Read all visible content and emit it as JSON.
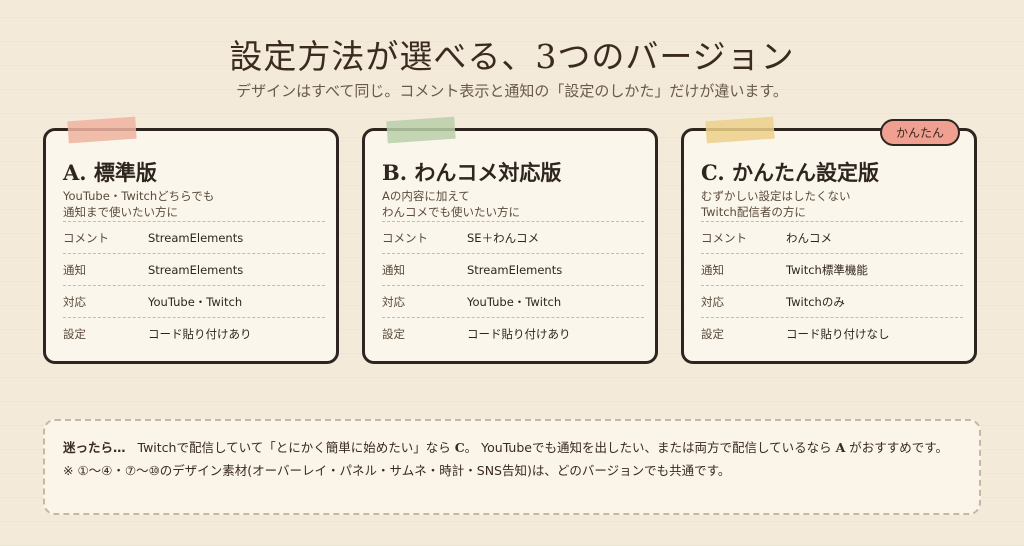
{
  "header": {
    "title": "設定方法が選べる、3つのバージョン",
    "subtitle": "デザインはすべて同じ。コメント表示と通知の「設定のしかた」だけが違います。"
  },
  "cards": [
    {
      "title": "A. 標準版",
      "desc_line1": "YouTube・Twitchどちらでも",
      "desc_line2": "通知まで使いたい方に",
      "rows": [
        {
          "key": "コメント",
          "value": "StreamElements"
        },
        {
          "key": "通知",
          "value": "StreamElements"
        },
        {
          "key": "対応",
          "value": "YouTube・Twitch"
        },
        {
          "key": "設定",
          "value": "コード貼り付けあり"
        }
      ]
    },
    {
      "title": "B. わんコメ対応版",
      "desc_line1": "Aの内容に加えて",
      "desc_line2": "わんコメでも使いたい方に",
      "rows": [
        {
          "key": "コメント",
          "value": "SE＋わんコメ"
        },
        {
          "key": "通知",
          "value": "StreamElements"
        },
        {
          "key": "対応",
          "value": "YouTube・Twitch"
        },
        {
          "key": "設定",
          "value": "コード貼り付けあり"
        }
      ]
    },
    {
      "title": "C. かんたん設定版",
      "badge": "かんたん",
      "desc_line1": "むずかしい設定はしたくない",
      "desc_line2": "Twitch配信者の方に",
      "rows": [
        {
          "key": "コメント",
          "value": "わんコメ"
        },
        {
          "key": "通知",
          "value": "Twitch標準機能"
        },
        {
          "key": "対応",
          "value": "Twitchのみ"
        },
        {
          "key": "設定",
          "value": "コード貼り付けなし"
        }
      ]
    }
  ],
  "note": {
    "lead": "迷ったら…",
    "text_1": "Twitchで配信していて「とにかく簡単に始めたい」なら",
    "emph_c": "C",
    "text_2": "。 YouTubeでも通知を出したい、または両方で配信しているなら",
    "emph_a": "A",
    "text_3": "がおすすめです。",
    "line2": "※ ①〜④・⑦〜⑩のデザイン素材(オーバーレイ・パネル・サムネ・時計・SNS告知)は、どのバージョンでも共通です。"
  },
  "colors": {
    "background": "#f3ead9",
    "card_background": "#fbf6ec",
    "border": "#2f2520",
    "tape_a": "#efb3a0",
    "tape_b": "#b9cfa9",
    "tape_c": "#ecd08a",
    "badge": "#f0a090"
  }
}
